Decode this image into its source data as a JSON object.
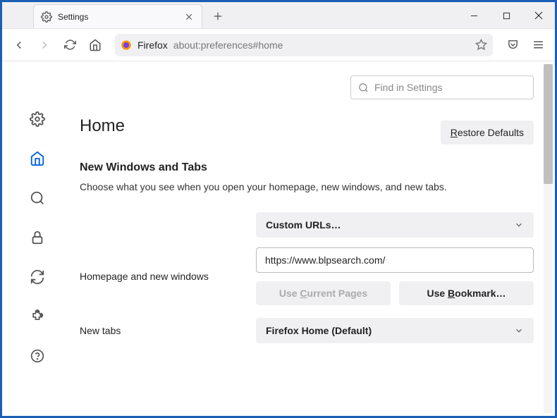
{
  "tab": {
    "title": "Settings"
  },
  "urlbar": {
    "domain": "Firefox",
    "path": "about:preferences#home"
  },
  "search": {
    "placeholder": "Find in Settings"
  },
  "page": {
    "title": "Home"
  },
  "buttons": {
    "restore": "Restore Defaults",
    "use_current": "Use Current Pages",
    "use_bookmark": "Use Bookmark…"
  },
  "section": {
    "title": "New Windows and Tabs",
    "desc": "Choose what you see when you open your homepage, new windows, and new tabs."
  },
  "rows": {
    "homepage_label": "Homepage and new windows",
    "newtabs_label": "New tabs"
  },
  "selects": {
    "custom_urls": "Custom URLs…",
    "firefox_home": "Firefox Home (Default)"
  },
  "inputs": {
    "homepage_value": "https://www.blpsearch.com/"
  }
}
